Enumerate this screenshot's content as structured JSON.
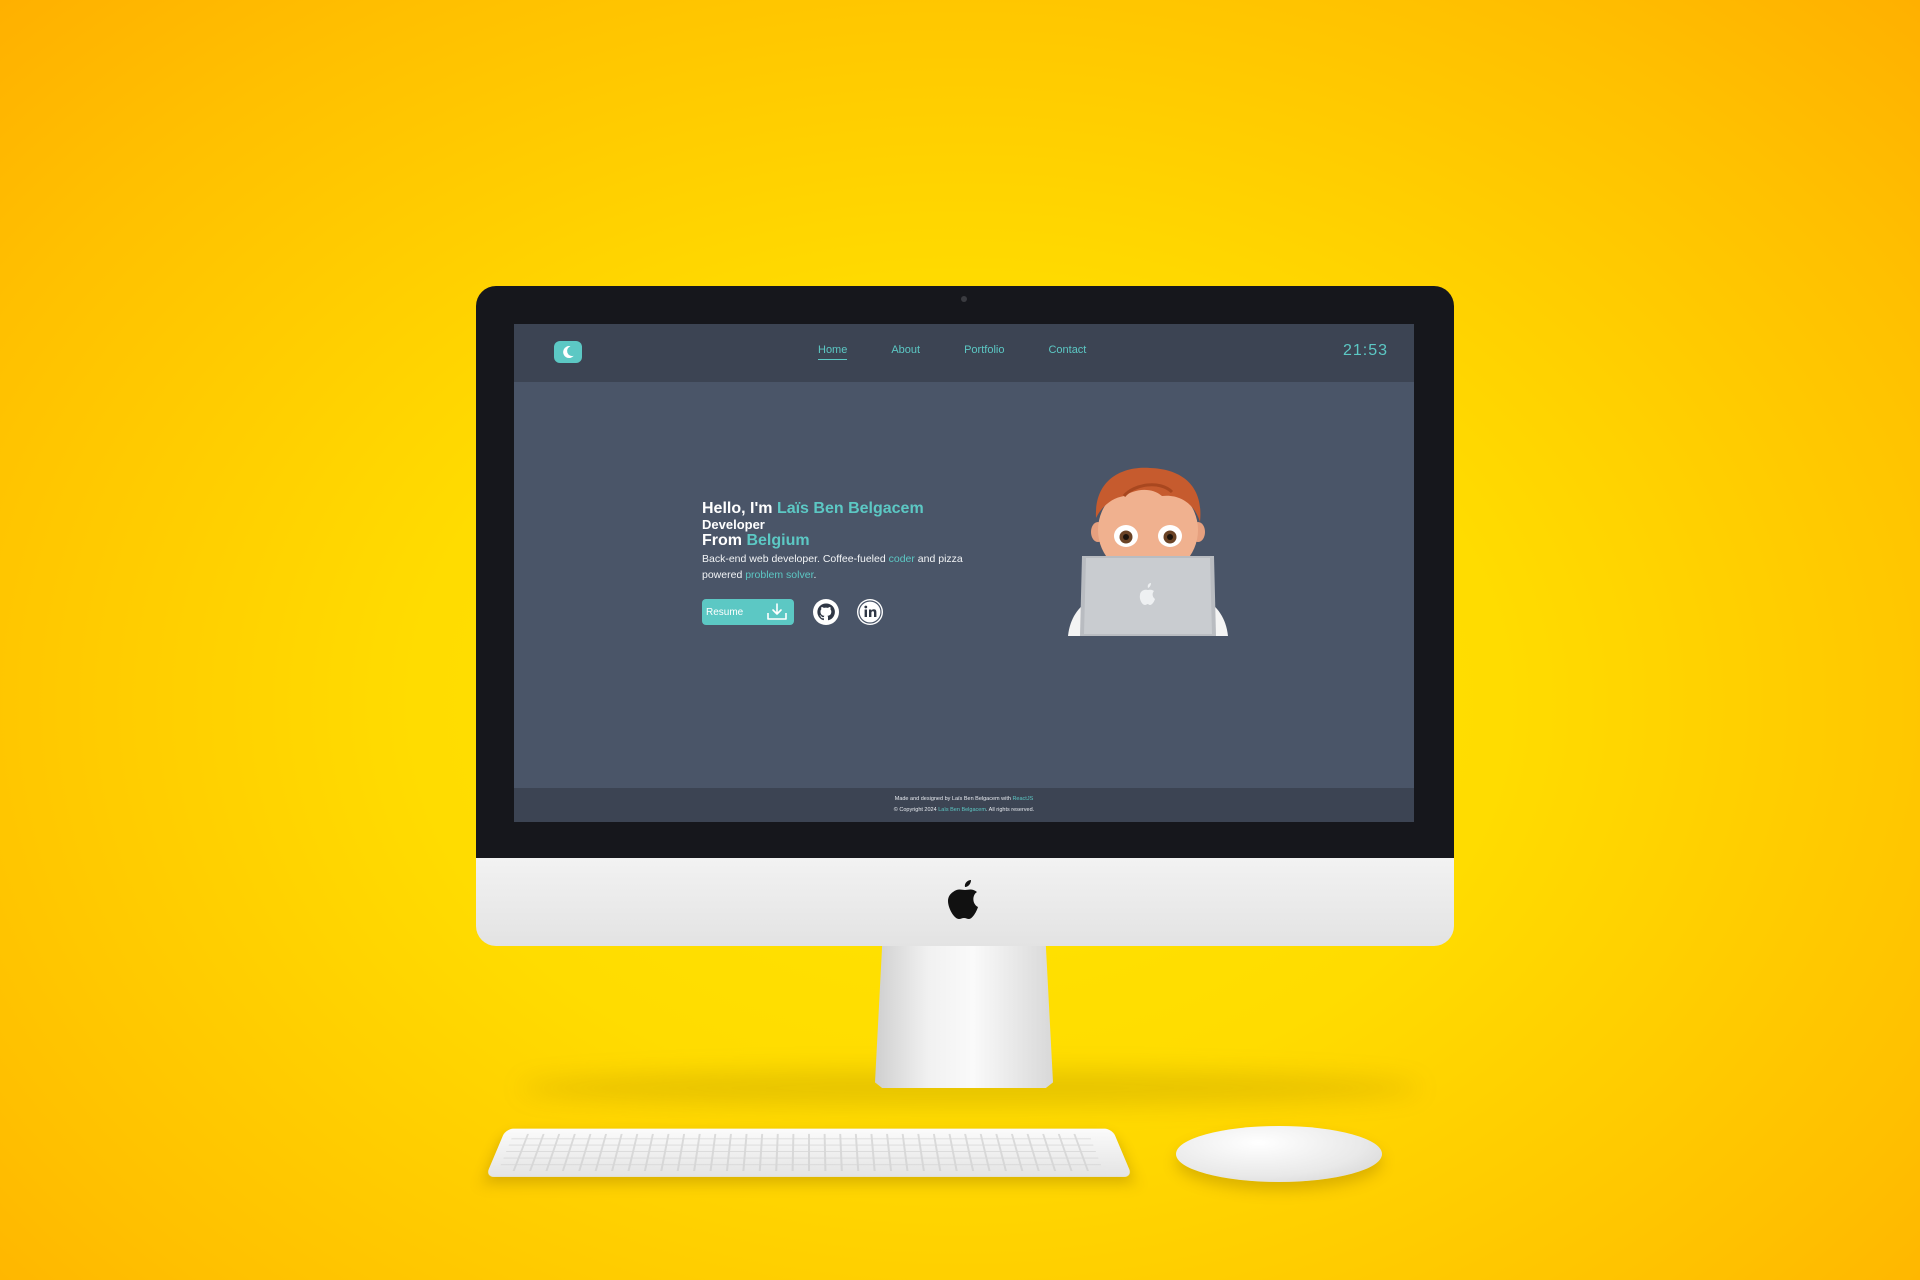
{
  "nav": {
    "links": [
      "Home",
      "About",
      "Portfolio",
      "Contact"
    ],
    "clock": "21:53"
  },
  "hero": {
    "greeting_prefix": "Hello, I'm ",
    "name": "Laïs Ben Belgacem",
    "role": "Developer",
    "from_prefix": "From ",
    "country": "Belgium",
    "desc_part1": "Back-end web developer. Coffee-fueled ",
    "desc_accent1": "coder",
    "desc_part2": " and pizza powered ",
    "desc_accent2": "problem solver",
    "desc_part3": ".",
    "resume_label": "Resume"
  },
  "social": {
    "icons": [
      "github-icon",
      "linkedin-icon"
    ]
  },
  "footer": {
    "line1_prefix": "Made and designed by Laïs Ben Belgacem with ",
    "line1_accent": "ReactJS",
    "line2_prefix": "© Copyright 2024 ",
    "line2_accent": "Laïs Ben Belgacem",
    "line2_suffix": ". All rights reserved."
  },
  "colors": {
    "accent": "#5cc8c4",
    "page_background": "#4a5568",
    "nav_background": "#3c4453",
    "backdrop": "#ffd700"
  }
}
